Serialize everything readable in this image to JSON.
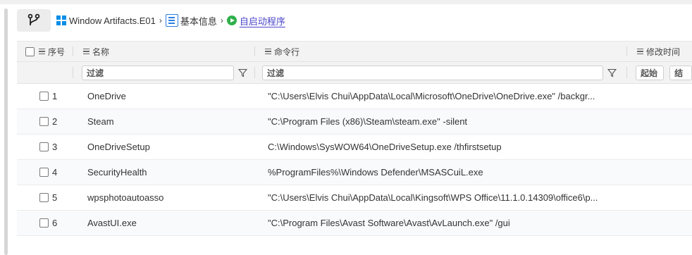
{
  "breadcrumb": {
    "items": [
      {
        "label": "Window Artifacts.E01",
        "icon": "windows-icon"
      },
      {
        "label": "基本信息",
        "icon": "list-icon"
      },
      {
        "label": "自启动程序",
        "icon": "play-circle-icon"
      }
    ]
  },
  "table": {
    "headers": {
      "index": "序号",
      "name": "名称",
      "command": "命令行",
      "modified": "修改时间"
    },
    "filters": {
      "name": "过滤",
      "command": "过滤",
      "time_start": "起始",
      "time_end": "结"
    },
    "rows": [
      {
        "index": "1",
        "name": "OneDrive",
        "command": "\"C:\\Users\\Elvis Chui\\AppData\\Local\\Microsoft\\OneDrive\\OneDrive.exe\" /backgr..."
      },
      {
        "index": "2",
        "name": "Steam",
        "command": "\"C:\\Program Files (x86)\\Steam\\steam.exe\" -silent"
      },
      {
        "index": "3",
        "name": "OneDriveSetup",
        "command": "C:\\Windows\\SysWOW64\\OneDriveSetup.exe /thfirstsetup"
      },
      {
        "index": "4",
        "name": "SecurityHealth",
        "command": "%ProgramFiles%\\Windows Defender\\MSASCuiL.exe"
      },
      {
        "index": "5",
        "name": "wpsphotoautoasso",
        "command": "\"C:\\Users\\Elvis Chui\\AppData\\Local\\Kingsoft\\WPS Office\\11.1.0.14309\\office6\\p..."
      },
      {
        "index": "6",
        "name": "AvastUI.exe",
        "command": "\"C:\\Program Files\\Avast Software\\Avast\\AvLaunch.exe\" /gui"
      }
    ]
  },
  "colors": {
    "accent": "#4a45c8",
    "windows_blue": "#0a8ee8",
    "green": "#2fb04a"
  }
}
